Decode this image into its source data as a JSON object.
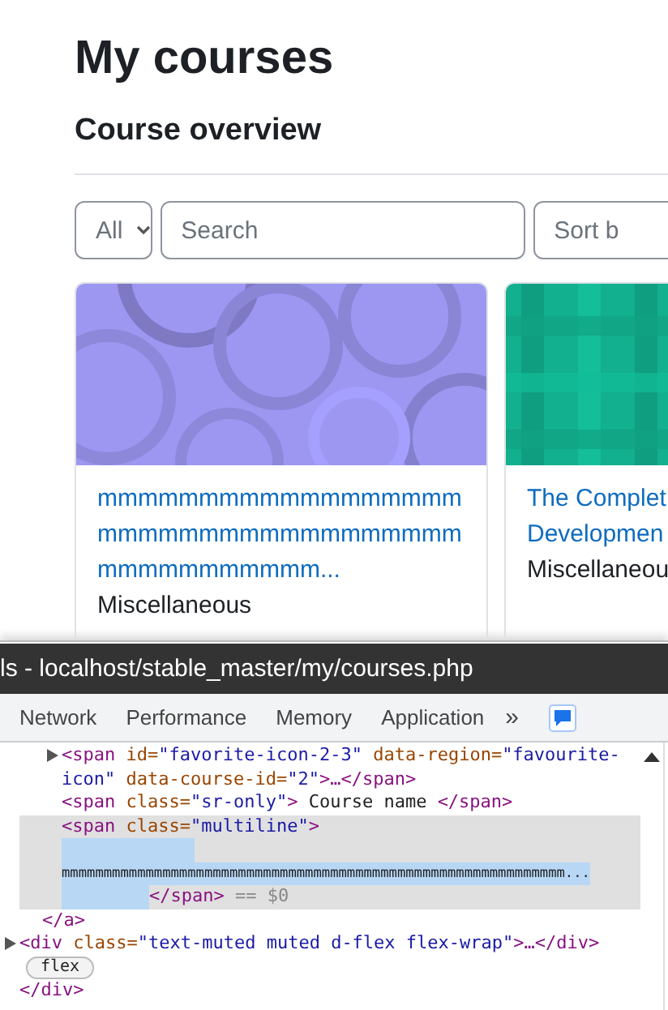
{
  "page": {
    "title": "My courses",
    "subtitle": "Course overview",
    "filters": {
      "grouping": "All",
      "search_placeholder": "Search",
      "sort": "Sort b"
    },
    "courses": [
      {
        "title": "mmmmmmmmmmmmmmmmmmmmmmmmmmmmmmmmmmmmmmmmmmmmmmm...",
        "category": "Miscellaneous",
        "image": {
          "kind": "circles",
          "color": "#9d97f2"
        }
      },
      {
        "title": "The Complet Developmen",
        "category": "Miscellaneou",
        "image": {
          "kind": "plaid",
          "color": "#12b08e"
        }
      }
    ]
  },
  "devtools": {
    "title": "ls - localhost/stable_master/my/courses.php",
    "tabs": [
      {
        "label": "Network",
        "selected": false
      },
      {
        "label": "Performance",
        "selected": false
      },
      {
        "label": "Memory",
        "selected": false
      },
      {
        "label": "Application",
        "selected": false
      }
    ],
    "more": "»",
    "tree": {
      "children": [
        {
          "children": [
            {
              "expanded": false,
              "parts": [
                {
                  "kind": "tag",
                  "text": "<span"
                },
                {
                  "kind": "attr",
                  "text": " id="
                },
                {
                  "kind": "value",
                  "text": "\"favorite-icon-2-3\""
                },
                {
                  "kind": "attr",
                  "text": " data-region="
                },
                {
                  "kind": "value",
                  "text": "\"favourite-icon\""
                },
                {
                  "kind": "attr",
                  "text": " data-course-id="
                },
                {
                  "kind": "value",
                  "text": "\"2\""
                },
                {
                  "kind": "tag",
                  "text": ">…</span>"
                }
              ]
            },
            {
              "parts": [
                {
                  "kind": "tag",
                  "text": "<span"
                },
                {
                  "kind": "attr",
                  "text": " class="
                },
                {
                  "kind": "value",
                  "text": "\"sr-only\""
                },
                {
                  "kind": "tag",
                  "text": ">"
                },
                {
                  "kind": "text",
                  "text": " Course name "
                },
                {
                  "kind": "tag",
                  "text": "</span>"
                }
              ]
            },
            {
              "selected": true,
              "parts": [
                {
                  "kind": "tag",
                  "text": "<span"
                },
                {
                  "kind": "attr",
                  "text": " class="
                },
                {
                  "kind": "value",
                  "text": "\"multiline\""
                },
                {
                  "kind": "tag",
                  "text": ">"
                }
              ],
              "text": {
                "value": "mmmmmmmmmmmmmmmmmmmmmmmmmmmmmmmmmmmmmmmmmmmmmmmmmmmmmmmmmmmm...",
                "highlighted": true
              },
              "close": [
                {
                  "kind": "tag",
                  "text": "</span>"
                },
                {
                  "kind": "comment",
                  "text": " == $0"
                }
              ]
            }
          ],
          "close": [
            {
              "kind": "tag",
              "text": "</a>"
            }
          ]
        },
        {
          "expanded": false,
          "parts": [
            {
              "kind": "tag",
              "text": "<div"
            },
            {
              "kind": "attr",
              "text": " class="
            },
            {
              "kind": "value",
              "text": "\"text-muted muted d-flex flex-wrap\""
            },
            {
              "kind": "tag",
              "text": ">…</div>"
            }
          ],
          "badge": "flex"
        }
      ],
      "close": [
        {
          "kind": "tag",
          "text": "</div>"
        }
      ]
    }
  }
}
